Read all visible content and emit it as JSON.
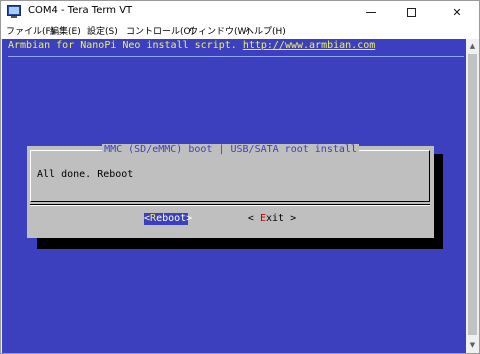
{
  "window": {
    "title": "COM4 - Tera Term VT",
    "app_icon": "tera-term-icon",
    "min_icon": "minimize-icon",
    "max_icon": "maximize-icon",
    "close_icon": "close-icon",
    "close_glyph": "✕"
  },
  "menu": {
    "items": [
      "ファイル(F)",
      "編集(E)",
      "設定(S)",
      "コントロール(O)",
      "ウィンドウ(W)",
      "ヘルプ(H)"
    ]
  },
  "terminal": {
    "header_text": "Armbian for NanoPi Neo install script. ",
    "header_link": "http://www.armbian.com",
    "colors": {
      "background": "#3c3fbe",
      "header_text": "#f3f35a",
      "dialog": "#bfbfbf"
    }
  },
  "dialog": {
    "title": "MMC (SD/eMMC) boot | USB/SATA root install",
    "message": "All done. Reboot",
    "reboot_button": {
      "open": "<",
      "hotkey": "R",
      "rest": "eboot",
      "close": ">"
    },
    "exit_button": {
      "open": "< ",
      "hotkey": "E",
      "rest": "xit",
      "close": " >"
    }
  },
  "scrollbar": {
    "up_icon": "scroll-up-arrow-icon",
    "down_icon": "scroll-down-arrow-icon",
    "up_glyph": "▲",
    "down_glyph": "▼"
  }
}
